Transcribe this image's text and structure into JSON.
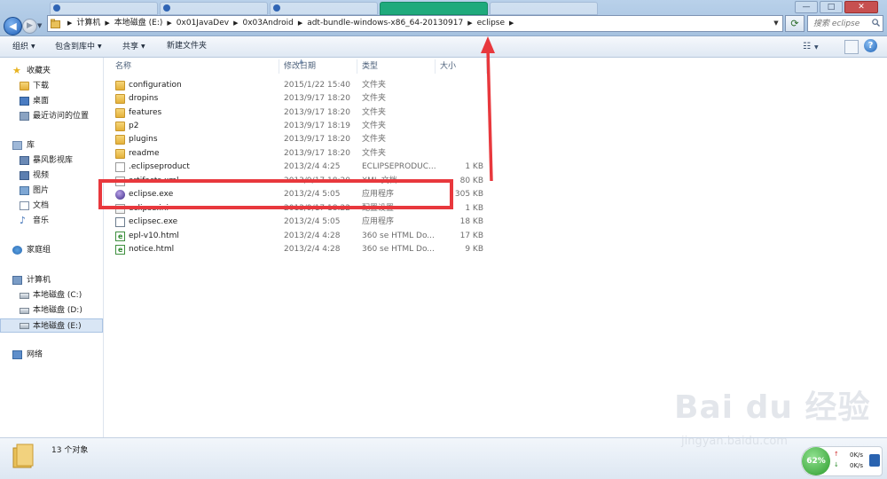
{
  "window": {
    "address_crumbs": [
      "计算机",
      "本地磁盘 (E:)",
      "0x01JavaDev",
      "0x03Android",
      "adt-bundle-windows-x86_64-20130917",
      "eclipse"
    ],
    "search_placeholder": "搜索 eclipse",
    "controls": {
      "minimize": "—",
      "maximize": "□",
      "close": "✕"
    }
  },
  "toolbar": {
    "organize": "组织",
    "include_in_library": "包含到库中",
    "share": "共享",
    "new_folder": "新建文件夹"
  },
  "nav": {
    "favorites_header": "收藏夹",
    "favorites": [
      "下载",
      "桌面",
      "最近访问的位置"
    ],
    "libraries_header": "库",
    "libraries": [
      "暴风影视库",
      "视频",
      "图片",
      "文档",
      "音乐"
    ],
    "homegroup": "家庭组",
    "computer_header": "计算机",
    "drives": [
      "本地磁盘 (C:)",
      "本地磁盘 (D:)",
      "本地磁盘 (E:)"
    ],
    "network": "网络"
  },
  "columns": {
    "name": "名称",
    "modified": "修改日期",
    "type": "类型",
    "size": "大小"
  },
  "files": [
    {
      "name": "configuration",
      "modified": "2015/1/22 15:40",
      "type": "文件夹",
      "size": "",
      "icon": "folder-icon"
    },
    {
      "name": "dropins",
      "modified": "2013/9/17 18:20",
      "type": "文件夹",
      "size": "",
      "icon": "folder-icon"
    },
    {
      "name": "features",
      "modified": "2013/9/17 18:20",
      "type": "文件夹",
      "size": "",
      "icon": "folder-icon"
    },
    {
      "name": "p2",
      "modified": "2013/9/17 18:19",
      "type": "文件夹",
      "size": "",
      "icon": "folder-icon"
    },
    {
      "name": "plugins",
      "modified": "2013/9/17 18:20",
      "type": "文件夹",
      "size": "",
      "icon": "folder-icon"
    },
    {
      "name": "readme",
      "modified": "2013/9/17 18:20",
      "type": "文件夹",
      "size": "",
      "icon": "folder-icon"
    },
    {
      "name": ".eclipseproduct",
      "modified": "2013/2/4 4:25",
      "type": "ECLIPSEPRODUC...",
      "size": "1 KB",
      "icon": "file-icon"
    },
    {
      "name": "artifacts.xml",
      "modified": "2013/9/17 18:20",
      "type": "XML 文档",
      "size": "80 KB",
      "icon": "xml-file-icon"
    },
    {
      "name": "eclipse.exe",
      "modified": "2013/2/4 5:05",
      "type": "应用程序",
      "size": "305 KB",
      "icon": "eclipse-icon"
    },
    {
      "name": "eclipse.ini",
      "modified": "2013/9/17 18:22",
      "type": "配置设置",
      "size": "1 KB",
      "icon": "ini-file-icon"
    },
    {
      "name": "eclipsec.exe",
      "modified": "2013/2/4 5:05",
      "type": "应用程序",
      "size": "18 KB",
      "icon": "console-exe-icon"
    },
    {
      "name": "epl-v10.html",
      "modified": "2013/2/4 4:28",
      "type": "360 se HTML Do...",
      "size": "17 KB",
      "icon": "html-file-icon"
    },
    {
      "name": "notice.html",
      "modified": "2013/2/4 4:28",
      "type": "360 se HTML Do...",
      "size": "9 KB",
      "icon": "html-file-icon"
    }
  ],
  "details": {
    "item_count": "13 个对象"
  },
  "watermark": {
    "brand": "Bai du 经验",
    "url": "jingyan.baidu.com"
  },
  "net_widget": {
    "percent": "62%",
    "up_rate": "0K/s",
    "down_rate": "0K/s"
  },
  "annotation_color": "#e8383d"
}
